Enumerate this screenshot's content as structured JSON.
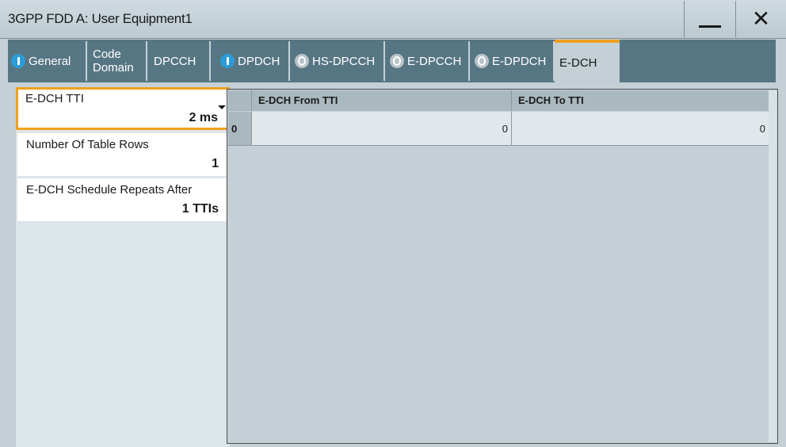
{
  "window": {
    "title": "3GPP FDD A: User Equipment1",
    "minimize_icon": "minimize-icon",
    "close_icon": "close-icon"
  },
  "tabs": [
    {
      "label": "General",
      "state": "on"
    },
    {
      "label": "Code Domain",
      "line1": "Code",
      "line2": "Domain",
      "state": "none"
    },
    {
      "label": "DPCCH",
      "state": "none"
    },
    {
      "label": "DPDCH",
      "state": "on"
    },
    {
      "label": "HS-DPCCH",
      "state": "off"
    },
    {
      "label": "E-DPCCH",
      "state": "off"
    },
    {
      "label": "E-DPDCH",
      "state": "off"
    },
    {
      "label": "E-DCH",
      "state": "active"
    }
  ],
  "fields": {
    "tti": {
      "label": "E-DCH TTI",
      "value": "2 ms"
    },
    "rows": {
      "label": "Number Of Table Rows",
      "value": "1"
    },
    "repeats": {
      "label": "E-DCH Schedule Repeats After",
      "value": "1 TTIs"
    }
  },
  "table": {
    "headers": [
      "E-DCH From TTI",
      "E-DCH To TTI"
    ],
    "rows": [
      {
        "index": "0",
        "from": "0",
        "to": "0"
      }
    ]
  },
  "colors": {
    "accent": "#f0a020",
    "tab_bg": "#577684",
    "indicator_on": "#2b9cd8"
  }
}
